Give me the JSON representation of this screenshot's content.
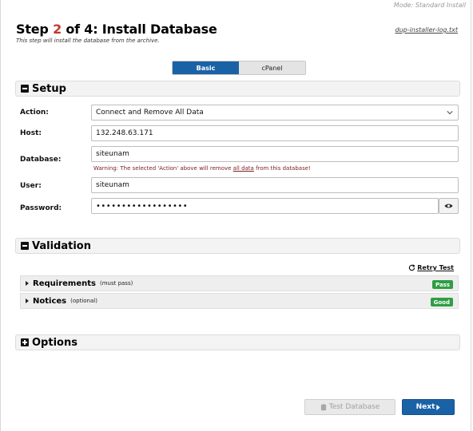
{
  "header": {
    "mode_text": "Mode: Standard Install",
    "title_prefix": "Step ",
    "step_current": "2",
    "title_suffix": " of 4: Install Database",
    "subtitle": "This step will install the database from the archive.",
    "log_link": "dup-installer-log.txt"
  },
  "mode_tabs": [
    {
      "label": "Basic",
      "active": true
    },
    {
      "label": "cPanel",
      "active": false
    }
  ],
  "setup": {
    "title": "Setup",
    "action_label": "Action:",
    "action_value": "Connect and Remove All Data",
    "host_label": "Host:",
    "host_value": "132.248.63.171",
    "database_label": "Database:",
    "database_value": "siteunam",
    "warning_before": "Warning: The selected 'Action' above will remove ",
    "warning_emph": "all data",
    "warning_after": " from this database!",
    "user_label": "User:",
    "user_value": "siteunam",
    "password_label": "Password:",
    "password_value": "••••••••••••••••••"
  },
  "validation": {
    "title": "Validation",
    "retry_label": "Retry Test",
    "rows": [
      {
        "name": "Requirements",
        "note": "(must pass)",
        "badge": "Pass"
      },
      {
        "name": "Notices",
        "note": "(optional)",
        "badge": "Good"
      }
    ]
  },
  "options": {
    "title": "Options"
  },
  "footer": {
    "test_label": "Test Database",
    "next_label": "Next"
  },
  "colors": {
    "accent": "#1a62a6",
    "step_red": "#c0392b",
    "badge_green": "#2f9e44",
    "warning": "#7a1f1f"
  }
}
